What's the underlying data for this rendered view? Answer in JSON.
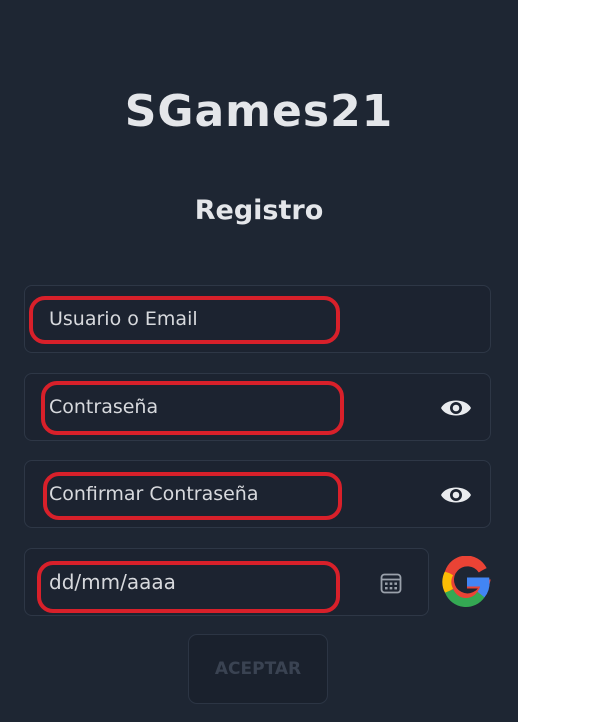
{
  "app": {
    "logo_text": "SGames21",
    "title": "Registro"
  },
  "form": {
    "username_placeholder": "Usuario o Email",
    "password_placeholder": "Contraseña",
    "confirm_password_placeholder": "Confirmar Contraseña",
    "date_placeholder": "dd/mm/aaaa",
    "submit_label": "ACEPTAR"
  },
  "icons": {
    "password_toggle": "eye-icon",
    "confirm_password_toggle": "eye-icon",
    "date_picker": "calendar-icon",
    "google_signin": "google-icon"
  },
  "colors": {
    "panel_background": "#1e2633",
    "text": "#e4e6ea",
    "highlight": "#d8202a",
    "button_disabled_text": "#3a4352"
  }
}
